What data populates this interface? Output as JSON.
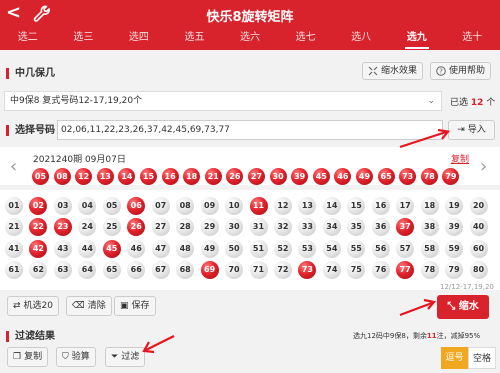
{
  "header": {
    "back_glyph": "<",
    "title": "快乐8旋转矩阵"
  },
  "tabs": [
    "选二",
    "选三",
    "选四",
    "选五",
    "选六",
    "选七",
    "选八",
    "选九",
    "选十"
  ],
  "active_tab": 7,
  "section1": {
    "title": "中几保几",
    "shrink_effect": "缩水效果",
    "help": "使用帮助"
  },
  "select": {
    "value": "中9保8 复式号码12-17,19,20个",
    "selected_prefix": "已选",
    "selected_count": "12",
    "selected_suffix": "个"
  },
  "pick": {
    "label": "选择号码",
    "value": "02,06,11,22,23,26,37,42,45,69,73,77",
    "import": "导入"
  },
  "draw": {
    "period": "2021240期 09月07日",
    "copy": "复制",
    "numbers": [
      "05",
      "08",
      "12",
      "13",
      "14",
      "15",
      "16",
      "18",
      "21",
      "26",
      "27",
      "30",
      "39",
      "45",
      "46",
      "49",
      "65",
      "73",
      "78",
      "79"
    ]
  },
  "grid": {
    "numbers": [
      "01",
      "02",
      "03",
      "04",
      "05",
      "06",
      "07",
      "08",
      "09",
      "10",
      "11",
      "12",
      "13",
      "14",
      "15",
      "16",
      "17",
      "18",
      "19",
      "20",
      "21",
      "22",
      "23",
      "24",
      "25",
      "26",
      "27",
      "28",
      "29",
      "30",
      "31",
      "32",
      "33",
      "34",
      "35",
      "36",
      "37",
      "38",
      "39",
      "40",
      "41",
      "42",
      "43",
      "44",
      "45",
      "46",
      "47",
      "48",
      "49",
      "50",
      "51",
      "52",
      "53",
      "54",
      "55",
      "56",
      "57",
      "58",
      "59",
      "60",
      "61",
      "62",
      "63",
      "64",
      "65",
      "66",
      "67",
      "68",
      "69",
      "70",
      "71",
      "72",
      "73",
      "74",
      "75",
      "76",
      "77",
      "78",
      "79",
      "80"
    ],
    "selected": [
      "02",
      "06",
      "11",
      "22",
      "23",
      "26",
      "37",
      "42",
      "45",
      "69",
      "73",
      "77"
    ],
    "date": "12/12-17,19,20"
  },
  "actions": {
    "random": "机选20",
    "clear": "清除",
    "save": "保存",
    "shrink": "缩水"
  },
  "results": {
    "title": "过滤结果",
    "info_prefix": "选九12码中9保8，剩余",
    "info_count": "11",
    "info_suffix": "注，减掉95%",
    "copy": "复制",
    "verify": "验算",
    "filter": "过滤",
    "seg_active": "逗号",
    "seg": "空格"
  },
  "colors": {
    "brand": "#d8222c",
    "accent": "#f0a820"
  }
}
